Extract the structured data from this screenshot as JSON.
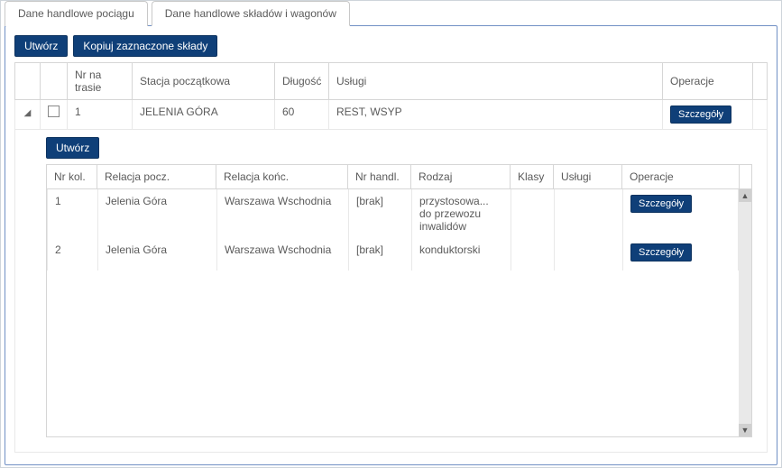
{
  "tabs": {
    "train": "Dane handlowe pociągu",
    "wagons": "Dane handlowe składów i wagonów"
  },
  "toolbar": {
    "create": "Utwórz",
    "copy": "Kopiuj zaznaczone składy"
  },
  "outer": {
    "headers": {
      "nr": "Nr na trasie",
      "stacja": "Stacja początkowa",
      "dlugosc": "Długość",
      "uslugi": "Usługi",
      "operacje": "Operacje"
    },
    "rows": [
      {
        "nr": "1",
        "stacja": "JELENIA GÓRA",
        "dl": "60",
        "uslugi": "REST, WSYP",
        "details": "Szczegóły"
      }
    ]
  },
  "inner": {
    "toolbar": {
      "create": "Utwórz"
    },
    "headers": {
      "nrkol": "Nr kol.",
      "rp": "Relacja pocz.",
      "rk": "Relacja końc.",
      "nh": "Nr handl.",
      "rodzaj": "Rodzaj",
      "klasy": "Klasy",
      "uslugi": "Usługi",
      "oper": "Operacje"
    },
    "rows": [
      {
        "nrkol": "1",
        "rp": "Jelenia Góra",
        "rk": "Warszawa Wschodnia",
        "nh": "[brak]",
        "rodzaj": "przystosowa... do przewozu inwalidów",
        "klasy": "",
        "uslugi": "",
        "details": "Szczegóły"
      },
      {
        "nrkol": "2",
        "rp": "Jelenia Góra",
        "rk": "Warszawa Wschodnia",
        "nh": "[brak]",
        "rodzaj": "konduktorski",
        "klasy": "",
        "uslugi": "",
        "details": "Szczegóły"
      }
    ]
  },
  "icons": {
    "expand": "◢",
    "up": "▲",
    "down": "▼"
  }
}
